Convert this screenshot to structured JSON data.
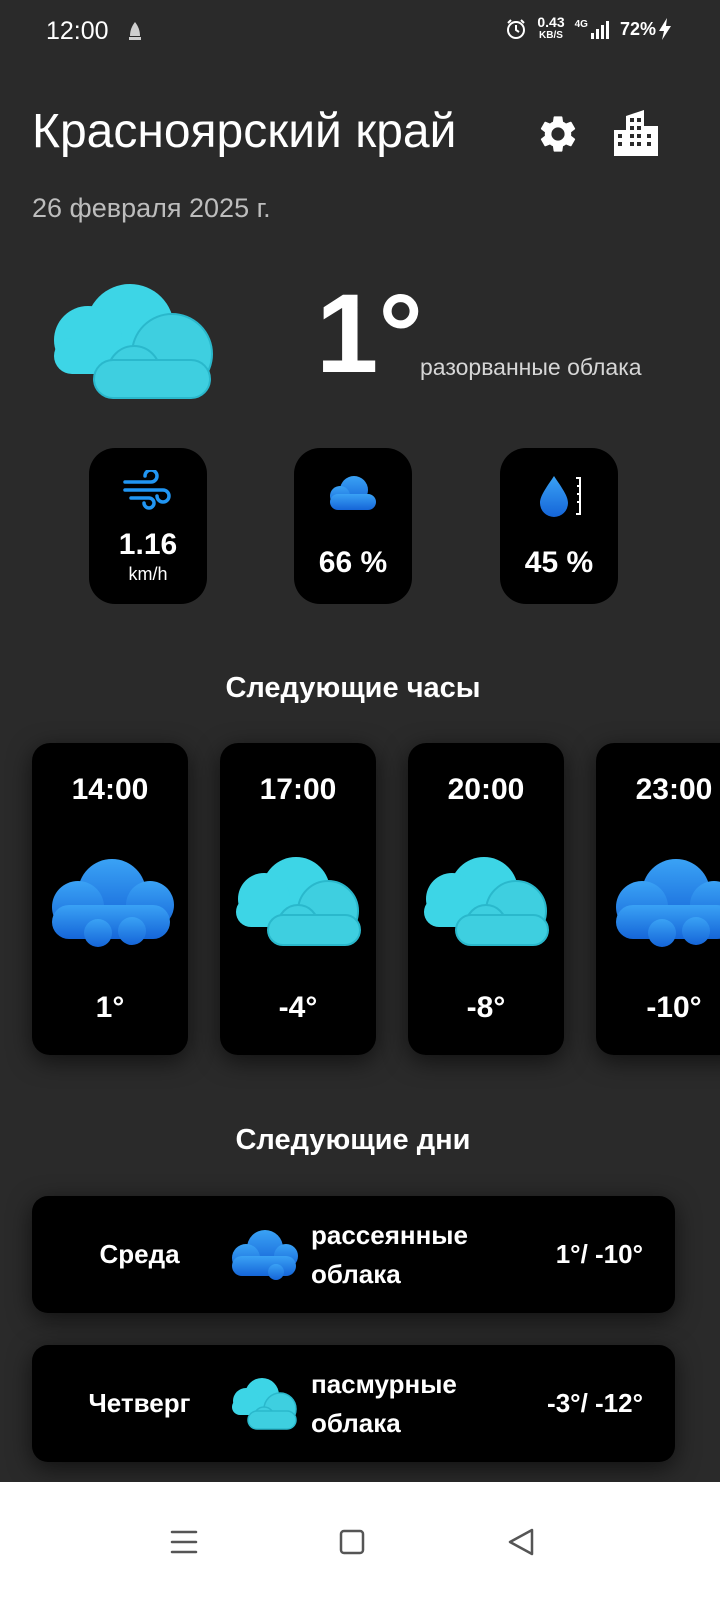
{
  "status_bar": {
    "time": "12:00",
    "speed_value": "0.43",
    "speed_unit": "KB/S",
    "network": "4G",
    "battery": "72%"
  },
  "header": {
    "city": "Красноярский край",
    "date": "26 февраля 2025 г.",
    "settings_icon": "gear-icon",
    "city_icon": "buildings-icon"
  },
  "current": {
    "temperature": "1°",
    "description": "разорванные облака",
    "icon": "broken-clouds-icon"
  },
  "stats": {
    "wind_value": "1.16",
    "wind_unit": "km/h",
    "cloudiness": "66 %",
    "humidity": "45 %"
  },
  "hourly": {
    "title": "Следующие часы",
    "items": [
      {
        "time": "14:00",
        "temp": "1°",
        "icon": "scattered-clouds-icon"
      },
      {
        "time": "17:00",
        "temp": "-4°",
        "icon": "broken-clouds-icon"
      },
      {
        "time": "20:00",
        "temp": "-8°",
        "icon": "broken-clouds-icon"
      },
      {
        "time": "23:00",
        "temp": "-10°",
        "icon": "scattered-clouds-icon"
      }
    ]
  },
  "daily": {
    "title": "Следующие дни",
    "items": [
      {
        "day": "Среда",
        "desc": "рассеянные облака",
        "temps": "1°/ -10°",
        "icon": "scattered-clouds-icon"
      },
      {
        "day": "Четверг",
        "desc": "пасмурные облака",
        "temps": "-3°/ -12°",
        "icon": "broken-clouds-icon"
      }
    ]
  },
  "colors": {
    "background": "#2a2a2a",
    "card": "#000000",
    "cyan_cloud": "#3dd5e6",
    "blue_cloud": "#1e88e5"
  }
}
